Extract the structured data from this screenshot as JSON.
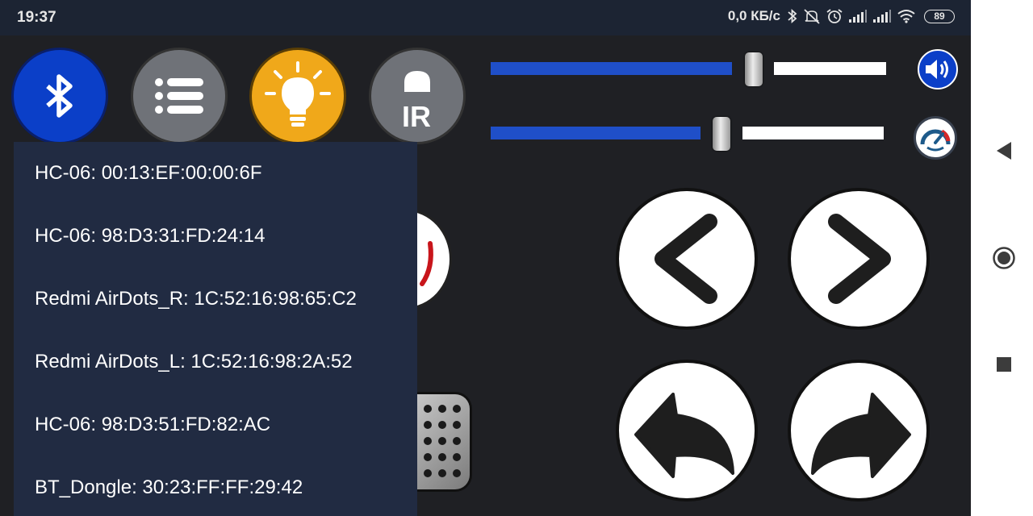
{
  "status_bar": {
    "time": "19:37",
    "network_speed": "0,0 КБ/с",
    "battery": "89",
    "icons": [
      "bluetooth-icon",
      "mute-icon",
      "alarm-icon",
      "signal-icon",
      "signal-icon",
      "wifi-icon",
      "battery-icon"
    ]
  },
  "toolbar": {
    "buttons": [
      {
        "name": "bluetooth-button",
        "icon": "bluetooth-icon",
        "color": "#0b3fc8"
      },
      {
        "name": "menu-button",
        "icon": "list-icon",
        "color": "#6f7278"
      },
      {
        "name": "light-button",
        "icon": "lightbulb-icon",
        "color": "#f0a81a"
      },
      {
        "name": "ir-button",
        "icon": "ir-icon",
        "label": "IR",
        "color": "#6f7278"
      }
    ]
  },
  "sliders": {
    "volume": {
      "level": 0.54,
      "icon": "speaker-icon"
    },
    "speed": {
      "level": 0.5,
      "icon": "speedometer-icon"
    }
  },
  "device_list": {
    "items": [
      "HC-06: 00:13:EF:00:00:6F",
      "HC-06: 98:D3:31:FD:24:14",
      "Redmi AirDots_R: 1C:52:16:98:65:C2",
      "Redmi AirDots_L: 1C:52:16:98:2A:52",
      "HC-06: 98:D3:51:FD:82:AC",
      "BT_Dongle: 30:23:FF:FF:29:42"
    ]
  },
  "controls": {
    "icons": [
      "chevron-left-icon",
      "chevron-right-icon",
      "turn-left-icon",
      "turn-right-icon",
      "horn-icon",
      "pedal-icon"
    ]
  },
  "nav_bar": {
    "icons": [
      "back-icon",
      "home-icon",
      "recents-icon"
    ]
  },
  "colors": {
    "accent": "#1f4fc8",
    "background": "#1f2024",
    "dropdown": "#212b42",
    "status_bar": "#1c2433"
  }
}
